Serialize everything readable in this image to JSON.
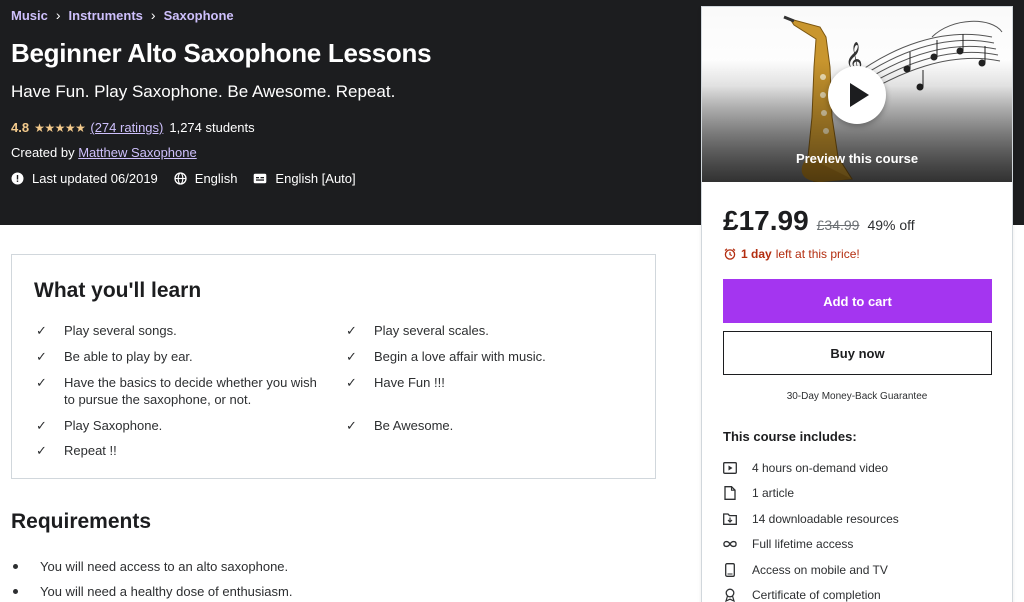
{
  "breadcrumb": [
    "Music",
    "Instruments",
    "Saxophone"
  ],
  "course": {
    "title": "Beginner Alto Saxophone Lessons",
    "subtitle": "Have Fun. Play Saxophone. Be Awesome. Repeat.",
    "rating": "4.8",
    "stars": "★★★★★",
    "ratings_count": "(274 ratings)",
    "students": "1,274 students",
    "created_by_label": "Created by",
    "instructor": "Matthew Saxophone",
    "last_updated": "Last updated 06/2019",
    "language": "English",
    "captions": "English [Auto]"
  },
  "learn": {
    "title": "What you'll learn",
    "left": [
      "Play several songs.",
      "Be able to play by ear.",
      "Have the basics to decide whether you wish to pursue the saxophone, or not.",
      "Play Saxophone.",
      "Repeat !!"
    ],
    "right": [
      "Play several scales.",
      "Begin a love affair with music.",
      "Have Fun !!!",
      "Be Awesome."
    ]
  },
  "requirements": {
    "title": "Requirements",
    "items": [
      "You will need access to an alto saxophone.",
      "You will need a healthy dose of enthusiasm."
    ]
  },
  "sidebar": {
    "preview_label": "Preview this course",
    "price": "£17.99",
    "original_price": "£34.99",
    "discount": "49% off",
    "timer_bold": "1 day",
    "timer_rest": "left at this price!",
    "add_to_cart": "Add to cart",
    "buy_now": "Buy now",
    "guarantee": "30-Day Money-Back Guarantee",
    "includes_title": "This course includes:",
    "includes": [
      {
        "icon": "video-icon",
        "label": "4 hours on-demand video"
      },
      {
        "icon": "article-icon",
        "label": "1 article"
      },
      {
        "icon": "download-folder-icon",
        "label": "14 downloadable resources"
      },
      {
        "icon": "infinity-icon",
        "label": "Full lifetime access"
      },
      {
        "icon": "mobile-icon",
        "label": "Access on mobile and TV"
      },
      {
        "icon": "certificate-icon",
        "label": "Certificate of completion"
      }
    ]
  },
  "colors": {
    "header_bg": "#1c1d1f",
    "accent_purple": "#a435f0",
    "link_lavender": "#cec0fc",
    "star_gold": "#f3ca8c",
    "timer_red": "#b32d0f"
  }
}
